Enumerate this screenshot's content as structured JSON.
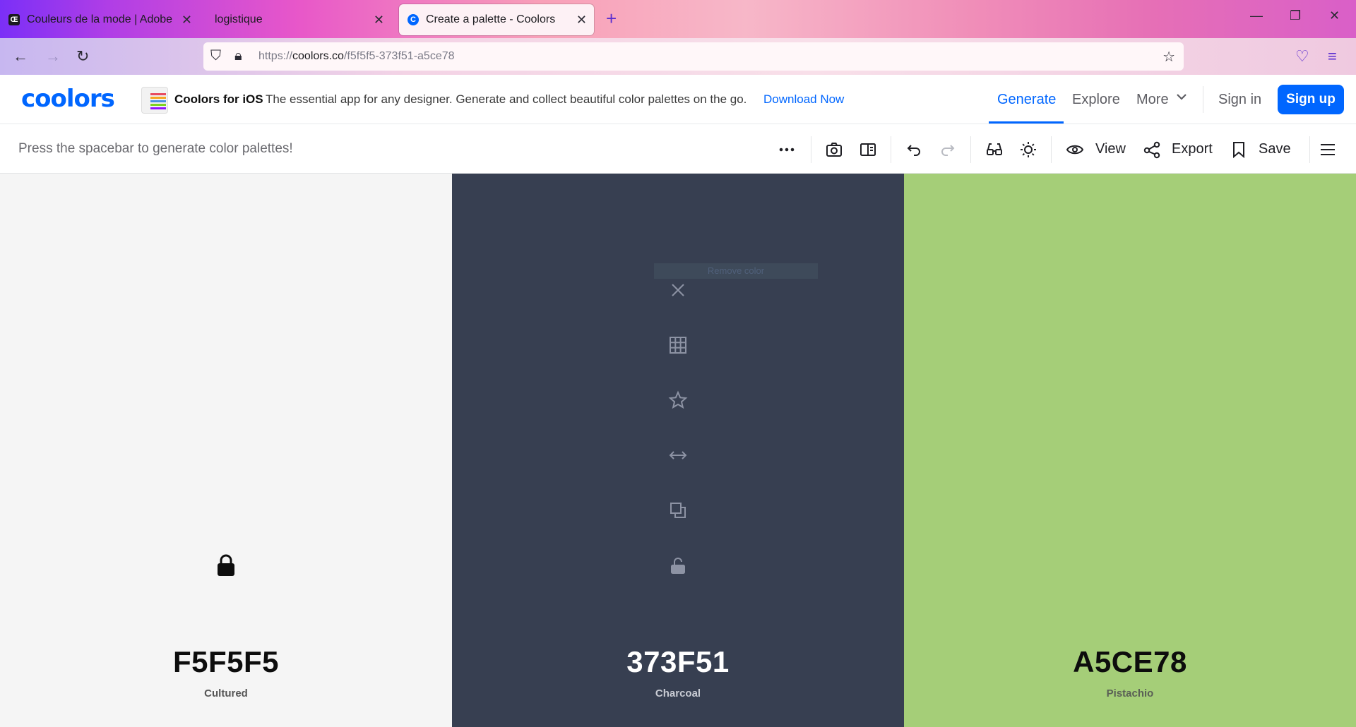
{
  "browser": {
    "tabs": [
      {
        "title": "Couleurs de la mode | Adobe C",
        "favicon": "adobe-icon",
        "active": false
      },
      {
        "title": "logistique",
        "favicon": "",
        "active": false
      },
      {
        "title": "Create a palette - Coolors",
        "favicon": "coolors-icon",
        "active": true
      }
    ],
    "url_prefix": "https://",
    "url_host": "coolors.co",
    "url_path": "/f5f5f5-373f51-a5ce78"
  },
  "header": {
    "logo": "coolors",
    "promo_title": "Coolors for iOS",
    "promo_text": "The essential app for any designer. Generate and collect beautiful color palettes on the go.",
    "promo_link": "Download Now",
    "nav": [
      "Generate",
      "Explore",
      "More"
    ],
    "sign_in": "Sign in",
    "sign_up": "Sign up"
  },
  "toolbar": {
    "hint": "Press the spacebar to generate color palettes!",
    "view_label": "View",
    "export_label": "Export",
    "save_label": "Save"
  },
  "palette": [
    {
      "hex": "F5F5F5",
      "name": "Cultured",
      "bg": "#f5f5f5",
      "fg": "#0d0d0d",
      "locked": true
    },
    {
      "hex": "373F51",
      "name": "Charcoal",
      "bg": "#373f51",
      "fg": "#ffffff",
      "locked": false
    },
    {
      "hex": "A5CE78",
      "name": "Pistachio",
      "bg": "#a5ce78",
      "fg": "#0d0d0d",
      "locked": false
    }
  ],
  "tooltip": "Remove color",
  "colors": {
    "accent": "#0066ff"
  }
}
